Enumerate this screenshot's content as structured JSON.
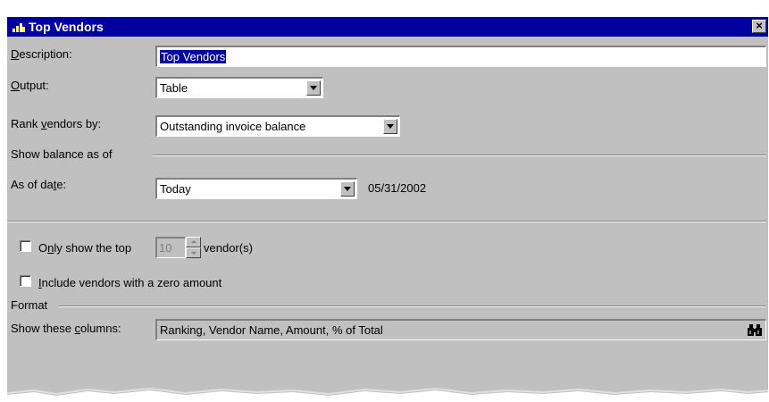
{
  "window": {
    "title": "Top Vendors",
    "close_label": "×"
  },
  "form": {
    "description": {
      "label_prefix": "",
      "label_hot": "D",
      "label_rest": "escription:",
      "value": "Top Vendors"
    },
    "output": {
      "label_hot": "O",
      "label_rest": "utput:",
      "value": "Table"
    },
    "rank": {
      "label_prefix": "Rank ",
      "label_hot": "v",
      "label_rest": "endors by:",
      "value": "Outstanding invoice balance"
    },
    "balance_group": {
      "label": "Show balance as of"
    },
    "as_of": {
      "label_prefix": "As of da",
      "label_hot": "t",
      "label_rest": "e:",
      "value": "Today",
      "date": "05/31/2002"
    },
    "only_top": {
      "label_prefix": "O",
      "label_hot": "n",
      "label_rest": "ly show the top",
      "value": "10",
      "suffix": "vendor(s)",
      "checked": false
    },
    "include_zero": {
      "label_hot": "I",
      "label_rest": "nclude vendors with a zero amount",
      "checked": false
    },
    "format_group": {
      "label": "Format"
    },
    "columns": {
      "label_prefix": "Show these ",
      "label_hot": "c",
      "label_rest": "olumns:",
      "value": "Ranking, Vendor Name, Amount, % of Total"
    }
  },
  "icons": {
    "title": "report-icon",
    "close": "close-icon",
    "dropdown": "chevron-down-icon",
    "browse": "binoculars-icon"
  },
  "colors": {
    "titlebar": "#0000a0",
    "face": "#c0c0c0",
    "selection": "#0000a0"
  }
}
